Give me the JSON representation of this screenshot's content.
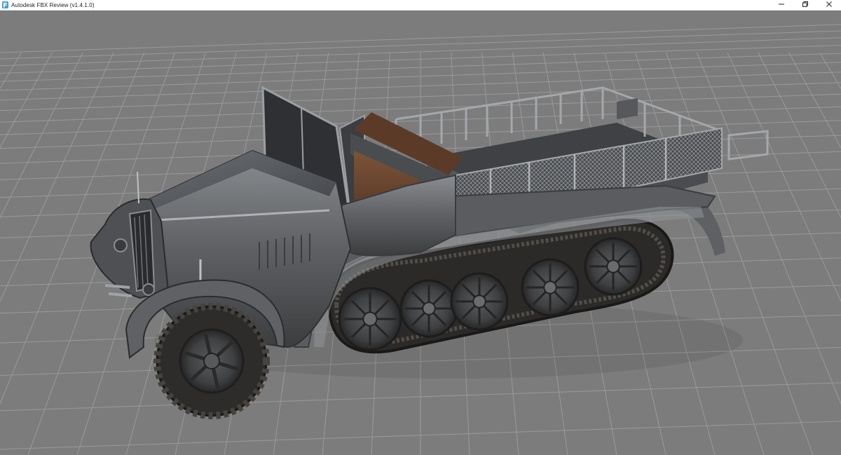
{
  "window": {
    "title": "Autodesk FBX Review (v1.4.1.0)",
    "app_icon": "fbx-review-app-icon",
    "controls": {
      "minimize_icon": "minimize-icon",
      "restore_icon": "restore-icon",
      "close_icon": "close-icon"
    }
  },
  "viewport": {
    "background_color": "#7c7c7c",
    "grid": true,
    "grid_color": "#9a9a9a",
    "model": {
      "description_icon": "halftrack-3d-model",
      "body_color": "#5e6063",
      "seat_color": "#6a4630",
      "tire_color": "#2e2c2a"
    }
  }
}
